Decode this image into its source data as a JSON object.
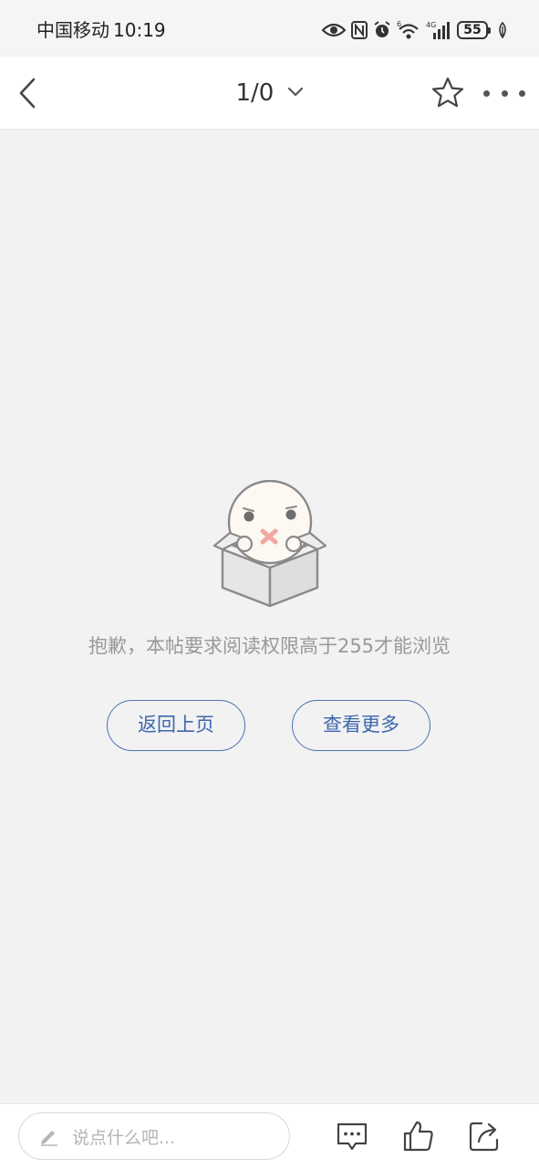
{
  "status_bar": {
    "carrier": "中国移动",
    "time": "10:19",
    "battery": "55",
    "icons": [
      "eye-icon",
      "nfc-icon",
      "alarm-icon",
      "wifi-icon",
      "signal-icon",
      "battery-icon",
      "leaf-icon"
    ]
  },
  "nav": {
    "page_indicator": "1/0",
    "icons": [
      "back-arrow-icon",
      "chevron-down-icon",
      "star-icon",
      "more-icon"
    ]
  },
  "empty_state": {
    "message": "抱歉，本帖要求阅读权限高于255才能浏览",
    "back_label": "返回上页",
    "more_label": "查看更多"
  },
  "bottom_bar": {
    "input_placeholder": "说点什么吧...",
    "icons": [
      "pencil-icon",
      "comment-icon",
      "like-icon",
      "share-icon"
    ]
  },
  "colors": {
    "accent": "#3d67ad",
    "background": "#f2f2f2",
    "message_text": "#999999"
  }
}
